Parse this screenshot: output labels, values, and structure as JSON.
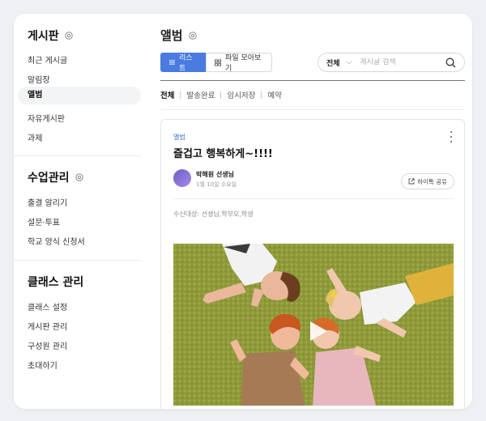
{
  "sidebar": {
    "board_title": "게시판",
    "board_items": [
      "최근 게시글",
      "알림장",
      "앨범",
      "자유게시판",
      "과제"
    ],
    "class_mgmt_title": "수업관리",
    "class_mgmt_items": [
      "출결 알리기",
      "설문·투표",
      "학교 양식 신청서"
    ],
    "class_admin_title": "클래스 관리",
    "class_admin_items": [
      "클래스 설정",
      "게시판 관리",
      "구성원 관리",
      "초대하기"
    ]
  },
  "main": {
    "title": "앨범",
    "view_list_label": "리스트",
    "view_gallery_label": "파일 모아보기",
    "search_filter": "전체",
    "search_placeholder": "게시글 검색",
    "tabs": [
      "전체",
      "발송완료",
      "임시저장",
      "예약"
    ]
  },
  "post": {
    "category": "앨범",
    "title": "즐겁고 행복하게~!!!!",
    "author": "박해원 선생님",
    "date": "1월 10일 수요일",
    "share_label": "하이톡 공유",
    "recipients": "수신대상: 선생님,학부모,학생"
  },
  "colors": {
    "accent": "#4a7be0",
    "category": "#3b6fd6",
    "carpet": "#8f9a3a"
  },
  "icons": [
    "gear-icon",
    "list-icon",
    "grid-icon",
    "chevron-down-icon",
    "search-icon",
    "kebab-icon",
    "share-icon",
    "play-icon"
  ]
}
